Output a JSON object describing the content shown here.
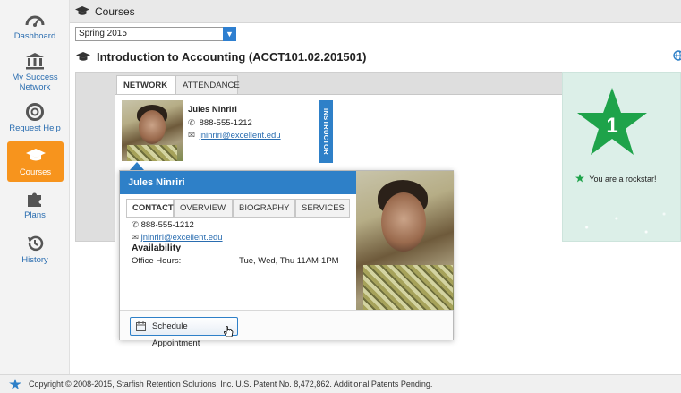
{
  "sidebar": {
    "items": [
      {
        "label": "Dashboard",
        "icon": "dashboard-icon"
      },
      {
        "label": "My Success Network",
        "icon": "building-icon"
      },
      {
        "label": "Request Help",
        "icon": "lifebuoy-icon"
      },
      {
        "label": "Courses",
        "icon": "graduation-cap-icon",
        "active": true
      },
      {
        "label": "Plans",
        "icon": "puzzle-icon"
      },
      {
        "label": "History",
        "icon": "history-icon"
      }
    ]
  },
  "header": {
    "title": "Courses"
  },
  "term_select": {
    "value": "Spring 2015"
  },
  "course": {
    "title": "Introduction to Accounting (ACCT101.02.201501)"
  },
  "tabs": [
    {
      "label": "NETWORK",
      "active": true
    },
    {
      "label": "ATTENDANCE"
    }
  ],
  "instructor_card": {
    "name": "Jules Ninriri",
    "phone": "888-555-1212",
    "email": "jninriri@excellent.edu",
    "role_tag": "INSTRUCTOR"
  },
  "popup": {
    "name": "Jules Ninriri",
    "tabs": [
      {
        "label": "CONTACT",
        "active": true
      },
      {
        "label": "OVERVIEW"
      },
      {
        "label": "BIOGRAPHY"
      },
      {
        "label": "SERVICES"
      }
    ],
    "phone": "888-555-1212",
    "email": "jninriri@excellent.edu",
    "availability_title": "Availability",
    "office_hours_label": "Office Hours:",
    "office_hours_value": "Tue, Wed, Thu 11AM-1PM",
    "schedule_button": "Schedule Appointment"
  },
  "widget": {
    "badge_number": "1",
    "message": "You are a rockstar!"
  },
  "footer": {
    "copyright": "Copyright © 2008-2015, Starfish Retention Solutions, Inc. U.S. Patent No. 8,472,862. Additional Patents Pending."
  },
  "colors": {
    "accent": "#2e80c8",
    "active_nav": "#f7941d",
    "star_green": "#1ea34a"
  }
}
